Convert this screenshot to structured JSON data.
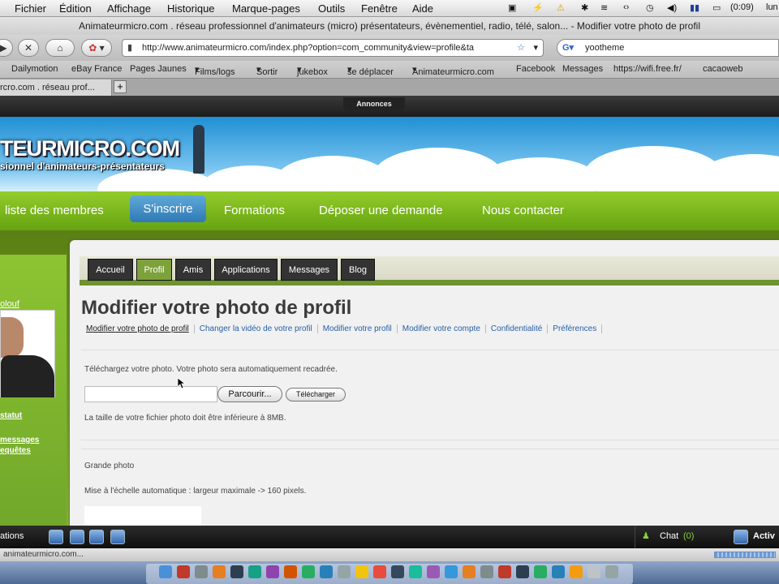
{
  "menubar": {
    "apple": "",
    "items": [
      "Fichier",
      "Édition",
      "Affichage",
      "Historique",
      "Marque-pages",
      "Outils",
      "Fenêtre",
      "Aide"
    ],
    "clock": "(0:09)",
    "day": "lun"
  },
  "window": {
    "title": "Animateurmicro.com . réseau professionnel d'animateurs (micro) présentateurs, évènementiel, radio, télé, salon... - Modifier votre photo de profil"
  },
  "toolbar": {
    "url": "http://www.animateurmicro.com/index.php?option=com_community&view=profile&ta",
    "search_value": "yootheme"
  },
  "bookmarks": [
    "Dailymotion",
    "eBay France",
    "Pages Jaunes",
    "Films/logs",
    "Sortir",
    "jukebox",
    "se déplacer",
    "Animateurmicro.com",
    "Facebook",
    "Messages",
    "https://wifi.free.fr/",
    "cacaoweb"
  ],
  "tabs": {
    "active": "rcro.com . réseau prof...",
    "new_tab": "+"
  },
  "site": {
    "ads_label": "Annonces",
    "logo_main": "TEURMICRO.COM",
    "logo_sub": "sionnel d'animateurs-présentateurs",
    "nav": [
      "liste des membres",
      "S'inscrire",
      "Formations",
      "Déposer une demande",
      "Nous contacter"
    ],
    "sidebar": {
      "name": "olouf",
      "status_link": "statut",
      "messages_link": "messages",
      "requests_link": "equêtes"
    },
    "profile_tabs": [
      "Accueil",
      "Profil",
      "Amis",
      "Applications",
      "Messages",
      "Blog"
    ],
    "page_title": "Modifier votre photo de profil",
    "sublinks": [
      "Modifier votre photo de profil",
      "Changer la vidéo de votre profil",
      "Modifier votre profil",
      "Modifier votre compte",
      "Confidentialité",
      "Préférences"
    ],
    "upload_instruction": "Téléchargez votre photo. Votre photo sera automatiquement recadrée.",
    "browse_button": "Parcourir...",
    "upload_button": "Télécharger",
    "size_note": "La taille de votre fichier photo doit être inférieure à 8MB.",
    "large_photo_label": "Grande photo",
    "large_photo_note": "Mise à l'échelle automatique : largeur maximale -> 160 pixels."
  },
  "bottombar": {
    "left_label": "ations",
    "chat_label": "Chat",
    "chat_count": "(0)",
    "right_label": "Activ"
  },
  "statusbar": {
    "text": "animateurmicro.com..."
  },
  "colors": {
    "nav_green": "#7bb81e",
    "signup_blue": "#3a87c4",
    "tab_active_green": "#7da23b",
    "link_blue": "#2860a8"
  }
}
